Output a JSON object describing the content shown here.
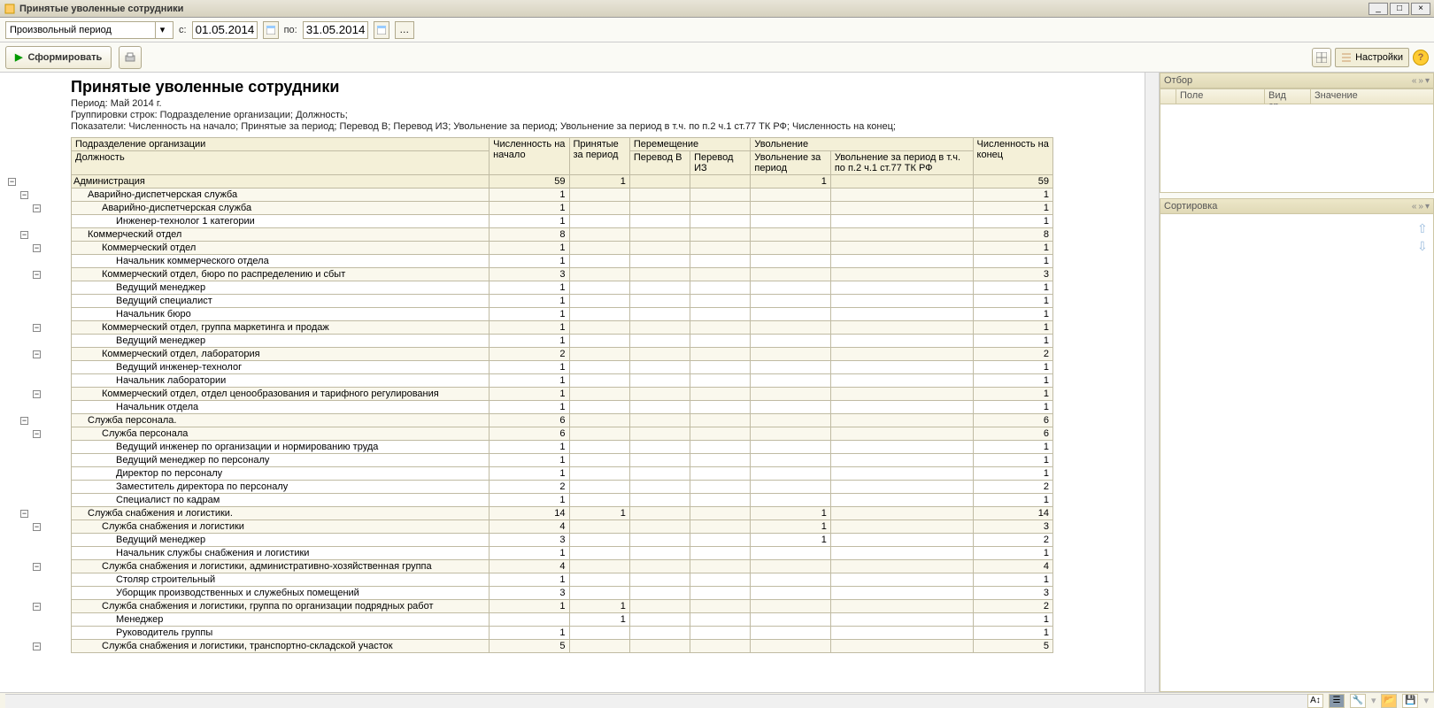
{
  "window": {
    "title": "Принятые уволенные сотрудники"
  },
  "toolbar": {
    "period_type": "Произвольный период",
    "from_lbl": "с:",
    "to_lbl": "по:",
    "date_from": "01.05.2014",
    "date_to": "31.05.2014",
    "generate": "Сформировать",
    "settings": "Настройки"
  },
  "report": {
    "title": "Принятые уволенные сотрудники",
    "period_line": "Период: Май 2014 г.",
    "group_line": "Группировки строк: Подразделение организации; Должность;",
    "metrics_line": "Показатели: Численность на начало; Принятые за период; Перевод В; Перевод ИЗ; Увольнение за период; Увольнение за период в т.ч. по п.2 ч.1 ст.77 ТК РФ; Численность на конец;",
    "hdr": {
      "org_unit": "Подразделение организации",
      "position": "Должность",
      "count_start": "Численность на начало",
      "hired": "Принятые за период",
      "transfer": "Перемещение",
      "transfer_in": "Перевод В",
      "transfer_out": "Перевод ИЗ",
      "fired_grp": "Увольнение",
      "fired": "Увольнение за период",
      "fired_art": "Увольнение за период в т.ч. по п.2 ч.1 ст.77 ТК РФ",
      "count_end": "Численность на конец"
    },
    "rows": [
      {
        "lv": 0,
        "name": "Администрация",
        "c": [
          59,
          1,
          "",
          "",
          1,
          "",
          59
        ]
      },
      {
        "lv": 1,
        "name": "Аварийно-диспетчерская служба",
        "c": [
          1,
          "",
          "",
          "",
          "",
          "",
          1
        ]
      },
      {
        "lv": 2,
        "name": "Аварийно-диспетчерская служба",
        "c": [
          1,
          "",
          "",
          "",
          "",
          "",
          1
        ]
      },
      {
        "lv": 3,
        "name": "Инженер-технолог 1 категории",
        "c": [
          1,
          "",
          "",
          "",
          "",
          "",
          1
        ]
      },
      {
        "lv": 1,
        "name": "Коммерческий отдел",
        "c": [
          8,
          "",
          "",
          "",
          "",
          "",
          8
        ]
      },
      {
        "lv": 2,
        "name": "Коммерческий отдел",
        "c": [
          1,
          "",
          "",
          "",
          "",
          "",
          1
        ]
      },
      {
        "lv": 3,
        "name": "Начальник коммерческого отдела",
        "c": [
          1,
          "",
          "",
          "",
          "",
          "",
          1
        ]
      },
      {
        "lv": 2,
        "name": "Коммерческий отдел, бюро по распределению и сбыт",
        "c": [
          3,
          "",
          "",
          "",
          "",
          "",
          3
        ]
      },
      {
        "lv": 3,
        "name": "Ведущий менеджер",
        "c": [
          1,
          "",
          "",
          "",
          "",
          "",
          1
        ]
      },
      {
        "lv": 3,
        "name": "Ведущий специалист",
        "c": [
          1,
          "",
          "",
          "",
          "",
          "",
          1
        ]
      },
      {
        "lv": 3,
        "name": "Начальник бюро",
        "c": [
          1,
          "",
          "",
          "",
          "",
          "",
          1
        ]
      },
      {
        "lv": 2,
        "name": "Коммерческий отдел, группа маркетинга и продаж",
        "c": [
          1,
          "",
          "",
          "",
          "",
          "",
          1
        ]
      },
      {
        "lv": 3,
        "name": "Ведущий менеджер",
        "c": [
          1,
          "",
          "",
          "",
          "",
          "",
          1
        ]
      },
      {
        "lv": 2,
        "name": "Коммерческий отдел, лаборатория",
        "c": [
          2,
          "",
          "",
          "",
          "",
          "",
          2
        ]
      },
      {
        "lv": 3,
        "name": "Ведущий инженер-технолог",
        "c": [
          1,
          "",
          "",
          "",
          "",
          "",
          1
        ]
      },
      {
        "lv": 3,
        "name": "Начальник лаборатории",
        "c": [
          1,
          "",
          "",
          "",
          "",
          "",
          1
        ]
      },
      {
        "lv": 2,
        "name": "Коммерческий отдел, отдел ценообразования и тарифного регулирования",
        "c": [
          1,
          "",
          "",
          "",
          "",
          "",
          1
        ]
      },
      {
        "lv": 3,
        "name": "Начальник отдела",
        "c": [
          1,
          "",
          "",
          "",
          "",
          "",
          1
        ]
      },
      {
        "lv": 1,
        "name": "Служба персонала.",
        "c": [
          6,
          "",
          "",
          "",
          "",
          "",
          6
        ]
      },
      {
        "lv": 2,
        "name": "Служба персонала",
        "c": [
          6,
          "",
          "",
          "",
          "",
          "",
          6
        ]
      },
      {
        "lv": 3,
        "name": "Ведущий инженер по организации и нормированию труда",
        "c": [
          1,
          "",
          "",
          "",
          "",
          "",
          1
        ]
      },
      {
        "lv": 3,
        "name": "Ведущий менеджер по персоналу",
        "c": [
          1,
          "",
          "",
          "",
          "",
          "",
          1
        ]
      },
      {
        "lv": 3,
        "name": "Директор по персоналу",
        "c": [
          1,
          "",
          "",
          "",
          "",
          "",
          1
        ]
      },
      {
        "lv": 3,
        "name": "Заместитель директора по персоналу",
        "c": [
          2,
          "",
          "",
          "",
          "",
          "",
          2
        ]
      },
      {
        "lv": 3,
        "name": "Специалист по кадрам",
        "c": [
          1,
          "",
          "",
          "",
          "",
          "",
          1
        ]
      },
      {
        "lv": 1,
        "name": "Служба снабжения и логистики.",
        "c": [
          14,
          1,
          "",
          "",
          1,
          "",
          14
        ]
      },
      {
        "lv": 2,
        "name": "Служба снабжения и логистики",
        "c": [
          4,
          "",
          "",
          "",
          1,
          "",
          3
        ]
      },
      {
        "lv": 3,
        "name": "Ведущий менеджер",
        "c": [
          3,
          "",
          "",
          "",
          1,
          "",
          2
        ]
      },
      {
        "lv": 3,
        "name": "Начальник службы снабжения и логистики",
        "c": [
          1,
          "",
          "",
          "",
          "",
          "",
          1
        ]
      },
      {
        "lv": 2,
        "name": "Служба снабжения и логистики, административно-хозяйственная группа",
        "c": [
          4,
          "",
          "",
          "",
          "",
          "",
          4
        ]
      },
      {
        "lv": 3,
        "name": "Столяр строительный",
        "c": [
          1,
          "",
          "",
          "",
          "",
          "",
          1
        ]
      },
      {
        "lv": 3,
        "name": "Уборщик производственных и служебных помещений",
        "c": [
          3,
          "",
          "",
          "",
          "",
          "",
          3
        ]
      },
      {
        "lv": 2,
        "name": "Служба снабжения и логистики, группа по организации подрядных работ",
        "c": [
          1,
          1,
          "",
          "",
          "",
          "",
          2
        ]
      },
      {
        "lv": 3,
        "name": "Менеджер",
        "c": [
          "",
          1,
          "",
          "",
          "",
          "",
          1
        ]
      },
      {
        "lv": 3,
        "name": "Руководитель группы",
        "c": [
          1,
          "",
          "",
          "",
          "",
          "",
          1
        ]
      },
      {
        "lv": 2,
        "name": "Служба снабжения и логистики, транспортно-складской участок",
        "c": [
          5,
          "",
          "",
          "",
          "",
          "",
          5
        ]
      }
    ]
  },
  "side": {
    "filter_title": "Отбор",
    "filter_cols": {
      "field": "Поле",
      "cmp": "Вид ср...",
      "value": "Значение"
    },
    "sort_title": "Сортировка"
  }
}
